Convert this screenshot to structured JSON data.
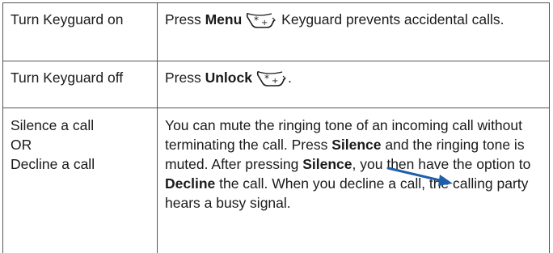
{
  "rows": [
    {
      "action": "Turn Keyguard on",
      "desc_before": "Press ",
      "desc_key": "Menu",
      "desc_after": " Keyguard prevents accidental calls.",
      "key_icon": "star-key-icon"
    },
    {
      "action": "Turn Keyguard off",
      "desc_before": "Press ",
      "desc_key": "Unlock",
      "desc_after": ".",
      "key_icon": "star-key-icon"
    },
    {
      "action_lines": [
        "Silence a call",
        "OR",
        "Decline a call"
      ],
      "desc_p1": "You can mute the ringing tone of an incoming call without terminating the call. Press ",
      "desc_k1": "Silence",
      "desc_p2": " and the ringing tone is muted. After pressing ",
      "desc_k2": "Silence",
      "desc_p3": ", you then have the option to ",
      "desc_k3": "Decline",
      "desc_p4": " the call. When you decline a call, the calling party hears a busy signal."
    }
  ],
  "colors": {
    "text": "#1a1a1a",
    "border": "#555555",
    "arrow": "#1f5fa8"
  }
}
